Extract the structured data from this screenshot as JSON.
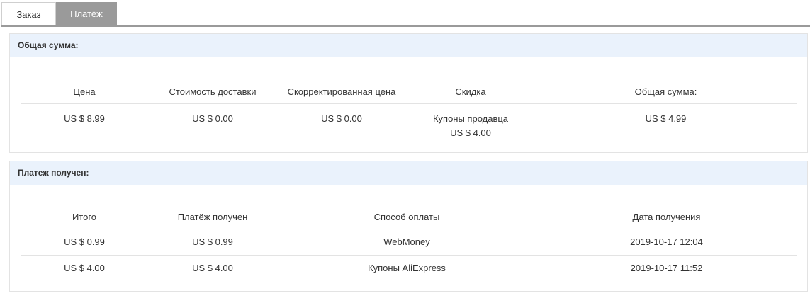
{
  "tabs": [
    {
      "label": "Заказ",
      "active": false
    },
    {
      "label": "Платёж",
      "active": true
    }
  ],
  "total_section": {
    "title": "Общая сумма:",
    "columns": [
      "Цена",
      "Стоимость доставки",
      "Скорректированная цена",
      "Скидка",
      "Общая сумма:"
    ],
    "row": {
      "price": "US $ 8.99",
      "shipping": "US $ 0.00",
      "adjusted": "US $ 0.00",
      "discount_label": "Купоны продавца",
      "discount_value": "US $ 4.00",
      "total": "US $ 4.99"
    }
  },
  "payment_section": {
    "title": "Платеж получен:",
    "columns": [
      "Итого",
      "Платёж получен",
      "Способ оплаты",
      "Дата получения"
    ],
    "rows": [
      {
        "total": "US $ 0.99",
        "received": "US $ 0.99",
        "method": "WebMoney",
        "date": "2019-10-17 12:04"
      },
      {
        "total": "US $ 4.00",
        "received": "US $ 4.00",
        "method": "Купоны AliExpress",
        "date": "2019-10-17 11:52"
      }
    ]
  },
  "colors": {
    "active_tab_bg": "#9a9a9a",
    "panel_header_bg": "#eaf2fc",
    "border": "#e3e3e3"
  }
}
